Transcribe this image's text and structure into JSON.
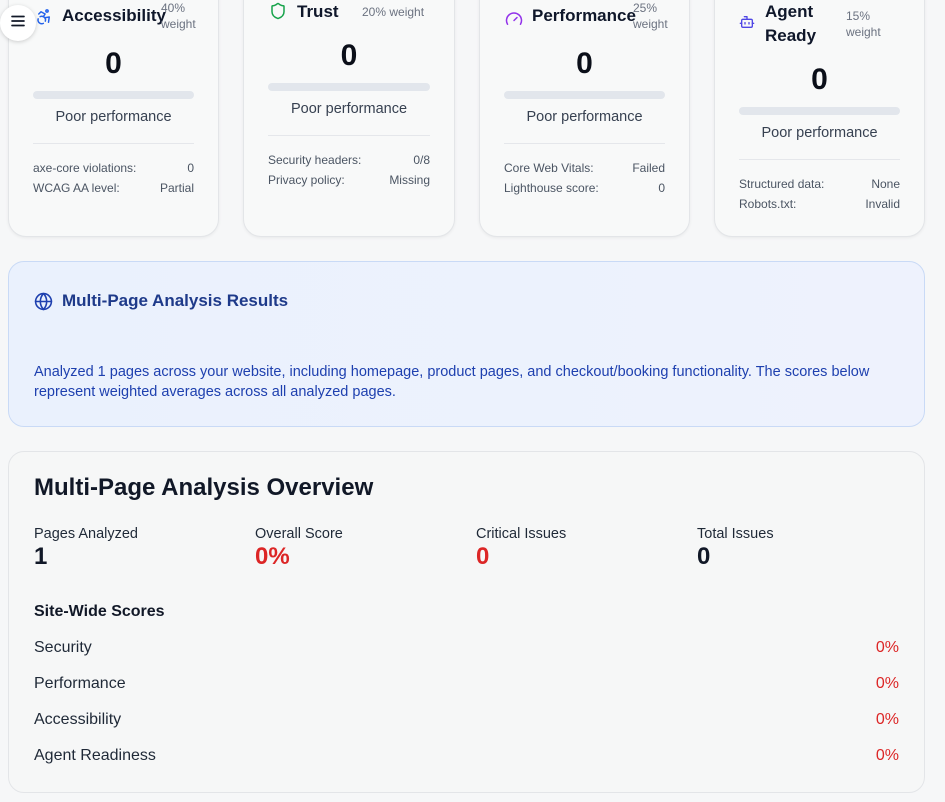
{
  "cards": [
    {
      "title": "Accessibility",
      "weight": "40% weight",
      "score": "0",
      "score_fraction": 0,
      "status": "Poor performance",
      "rows": [
        {
          "label": "axe-core violations:",
          "value": "0"
        },
        {
          "label": "WCAG AA level:",
          "value": "Partial"
        }
      ]
    },
    {
      "title": "Trust",
      "weight": "20% weight",
      "score": "0",
      "score_fraction": 0,
      "status": "Poor performance",
      "rows": [
        {
          "label": "Security headers:",
          "value": "0/8"
        },
        {
          "label": "Privacy policy:",
          "value": "Missing"
        }
      ]
    },
    {
      "title": "Performance",
      "weight": "25% weight",
      "score": "0",
      "score_fraction": 0,
      "status": "Poor performance",
      "rows": [
        {
          "label": "Core Web Vitals:",
          "value": "Failed"
        },
        {
          "label": "Lighthouse score:",
          "value": "0"
        }
      ]
    },
    {
      "title_line1": "Agent",
      "title_line2": "Ready",
      "weight": "15% weight",
      "score": "0",
      "score_fraction": 0,
      "status": "Poor performance",
      "rows": [
        {
          "label": "Structured data:",
          "value": "None"
        },
        {
          "label": "Robots.txt:",
          "value": "Invalid"
        }
      ]
    }
  ],
  "banner": {
    "title": "Multi-Page Analysis Results",
    "text": "Analyzed 1 pages across your website, including homepage, product pages, and checkout/booking functionality. The scores below represent weighted averages across all analyzed pages."
  },
  "overview": {
    "title": "Multi-Page Analysis Overview",
    "stats": [
      {
        "label": "Pages Analyzed",
        "value": "1"
      },
      {
        "label": "Overall Score",
        "value": "0%"
      },
      {
        "label": "Critical Issues",
        "value": "0"
      },
      {
        "label": "Total Issues",
        "value": "0"
      }
    ],
    "site_wide_title": "Site-Wide Scores",
    "site_wide": [
      {
        "label": "Security",
        "value": "0%"
      },
      {
        "label": "Performance",
        "value": "0%"
      },
      {
        "label": "Accessibility",
        "value": "0%"
      },
      {
        "label": "Agent Readiness",
        "value": "0%"
      }
    ]
  },
  "colors": {
    "accent_red": "#dc2626",
    "banner_blue": "#1e3a8a",
    "trust_green": "#16a34a",
    "perf_purple": "#9333ea",
    "agent_indigo": "#4f46e5"
  },
  "icons": [
    "menu-icon",
    "accessibility-icon",
    "shield-icon",
    "gauge-icon",
    "bot-icon",
    "globe-icon"
  ]
}
